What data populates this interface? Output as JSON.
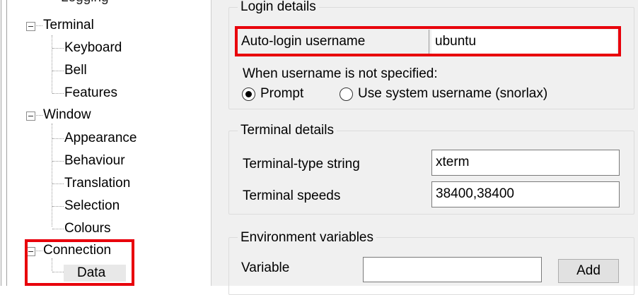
{
  "tree": {
    "items": [
      {
        "label": "Logging"
      },
      {
        "label": "Terminal"
      },
      {
        "label": "Keyboard"
      },
      {
        "label": "Bell"
      },
      {
        "label": "Features"
      },
      {
        "label": "Window"
      },
      {
        "label": "Appearance"
      },
      {
        "label": "Behaviour"
      },
      {
        "label": "Translation"
      },
      {
        "label": "Selection"
      },
      {
        "label": "Colours"
      },
      {
        "label": "Connection"
      },
      {
        "label": "Data"
      }
    ]
  },
  "login": {
    "group_title": "Login details",
    "autologin_label": "Auto-login username",
    "autologin_value": "ubuntu",
    "when_label": "When username is not specified:",
    "options": [
      {
        "label": "Prompt",
        "selected": true
      },
      {
        "label": "Use system username (snorlax)",
        "selected": false
      }
    ]
  },
  "terminal": {
    "group_title": "Terminal details",
    "type_label": "Terminal-type string",
    "type_value": "xterm",
    "speeds_label": "Terminal speeds",
    "speeds_value": "38400,38400"
  },
  "environment": {
    "group_title": "Environment variables",
    "variable_label": "Variable",
    "variable_value": "",
    "add_label": "Add"
  },
  "colors": {
    "highlight": "#e8000b",
    "panel_bg": "#f0f0f0",
    "tree_bg": "#ffffff"
  }
}
